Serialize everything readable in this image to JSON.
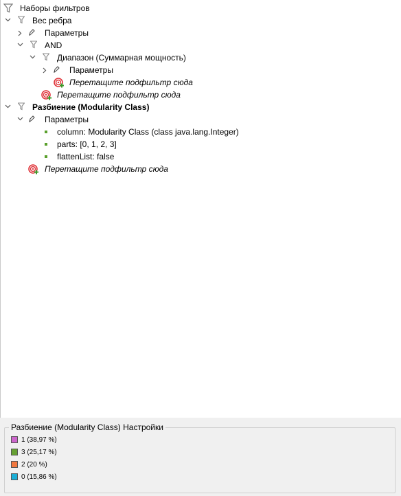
{
  "tree": {
    "root_label": "Наборы фильтров",
    "edge_weight_label": "Вес ребра",
    "edge_weight_params_label": "Параметры",
    "and_label": "AND",
    "range_label": "Диапазон (Суммарная мощность)",
    "range_params_label": "Параметры",
    "drop_hint_1": "Перетащите подфильтр сюда",
    "drop_hint_2": "Перетащите подфильтр сюда",
    "partition_label": "Разбиение (Modularity Class)",
    "partition_params_label": "Параметры",
    "param_column": "column: Modularity Class (class java.lang.Integer)",
    "param_parts": "parts: [0, 1, 2, 3]",
    "param_flatten": "flattenList: false",
    "drop_hint_3": "Перетащите подфильтр сюда"
  },
  "settings": {
    "title": "Разбиение (Modularity Class) Настройки",
    "parts": [
      {
        "label": "1 (38,97 %)",
        "color": "#cc66cc"
      },
      {
        "label": "3 (25,17 %)",
        "color": "#66a033"
      },
      {
        "label": "2 (20 %)",
        "color": "#f07840"
      },
      {
        "label": "0 (15,86 %)",
        "color": "#1aaed6"
      }
    ]
  },
  "colors": {
    "bullet": "#5aa02c",
    "funnel": "#8c8c8c",
    "drop_target": "#e0343a",
    "plus": "#3a9a2a"
  },
  "icons": [
    "funnel-icon",
    "params-icon",
    "drop-target-icon",
    "bullet-icon",
    "chevron-down-icon",
    "chevron-right-icon"
  ]
}
